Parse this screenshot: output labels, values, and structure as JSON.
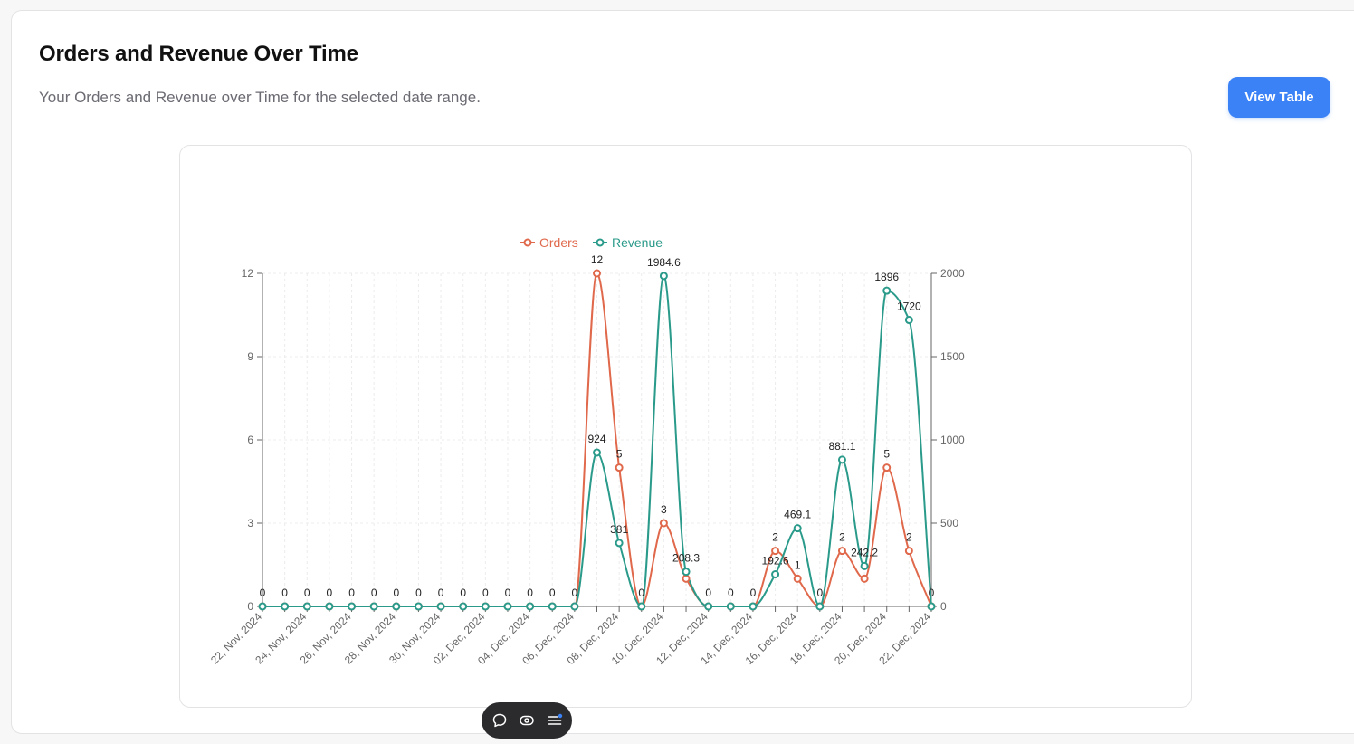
{
  "header": {
    "title": "Orders and Revenue Over Time",
    "subtitle": "Your Orders and Revenue over Time for the selected date range.",
    "view_table_label": "View Table"
  },
  "colors": {
    "orders": "#e0684b",
    "revenue": "#2a9a8a",
    "button": "#3b82f6"
  },
  "toolbar": {
    "icons": [
      "comment-icon",
      "eye-icon",
      "menu-icon"
    ]
  },
  "chart_data": {
    "type": "line",
    "title": "",
    "xlabel": "",
    "ylabel": "",
    "x": [
      "22, Nov, 2024",
      "23, Nov, 2024",
      "24, Nov, 2024",
      "25, Nov, 2024",
      "26, Nov, 2024",
      "27, Nov, 2024",
      "28, Nov, 2024",
      "29, Nov, 2024",
      "30, Nov, 2024",
      "01, Dec, 2024",
      "02, Dec, 2024",
      "03, Dec, 2024",
      "04, Dec, 2024",
      "05, Dec, 2024",
      "06, Dec, 2024",
      "07, Dec, 2024",
      "08, Dec, 2024",
      "09, Dec, 2024",
      "10, Dec, 2024",
      "11, Dec, 2024",
      "12, Dec, 2024",
      "13, Dec, 2024",
      "14, Dec, 2024",
      "15, Dec, 2024",
      "16, Dec, 2024",
      "17, Dec, 2024",
      "18, Dec, 2024",
      "19, Dec, 2024",
      "20, Dec, 2024",
      "21, Dec, 2024",
      "22, Dec, 2024"
    ],
    "x_tick_labels": [
      "22, Nov, 2024",
      "24, Nov, 2024",
      "26, Nov, 2024",
      "28, Nov, 2024",
      "30, Nov, 2024",
      "02, Dec, 2024",
      "04, Dec, 2024",
      "06, Dec, 2024",
      "08, Dec, 2024",
      "10, Dec, 2024",
      "12, Dec, 2024",
      "14, Dec, 2024",
      "16, Dec, 2024",
      "18, Dec, 2024",
      "20, Dec, 2024",
      "22, Dec, 2024"
    ],
    "series": [
      {
        "name": "Orders",
        "axis": "left",
        "color": "#e0684b",
        "values": [
          0,
          0,
          0,
          0,
          0,
          0,
          0,
          0,
          0,
          0,
          0,
          0,
          0,
          0,
          0,
          12,
          5,
          0,
          3,
          1,
          0,
          0,
          0,
          2,
          1,
          0,
          2,
          1,
          5,
          2,
          0
        ],
        "labels": [
          "0",
          "0",
          "0",
          "0",
          "0",
          "0",
          "0",
          "0",
          "0",
          "0",
          "0",
          "0",
          "0",
          "0",
          "0",
          "12",
          "5",
          "0",
          "3",
          "",
          "0",
          "0",
          "0",
          "2",
          "1",
          "0",
          "2",
          "",
          "5",
          "2",
          "0"
        ]
      },
      {
        "name": "Revenue",
        "axis": "right",
        "color": "#2a9a8a",
        "values": [
          0,
          0,
          0,
          0,
          0,
          0,
          0,
          0,
          0,
          0,
          0,
          0,
          0,
          0,
          0,
          924,
          381,
          0,
          1984.6,
          208.3,
          0,
          0,
          0,
          192.6,
          469.1,
          0,
          881.1,
          242.2,
          1896,
          1720,
          0
        ],
        "labels": [
          "",
          "",
          "",
          "",
          "",
          "",
          "",
          "",
          "",
          "",
          "",
          "",
          "",
          "",
          "",
          "924",
          "381",
          "",
          "1984.6",
          "208.3",
          "",
          "",
          "",
          "192.6",
          "469.1",
          "",
          "881.1",
          "242.2",
          "1896",
          "1720",
          ""
        ]
      }
    ],
    "y_left": {
      "ylim": [
        0,
        12
      ],
      "ticks": [
        "0",
        "3",
        "6",
        "9",
        "12"
      ]
    },
    "y_right": {
      "ylim": [
        0,
        2000
      ],
      "ticks": [
        "0",
        "500",
        "1000",
        "1500",
        "2000"
      ]
    },
    "legend_position": "top-center",
    "grid": true
  }
}
